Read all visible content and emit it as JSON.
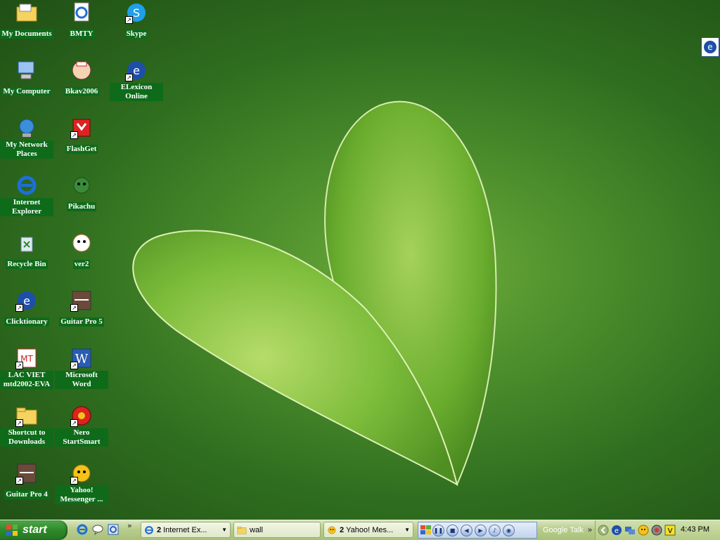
{
  "desktop": {
    "icons_col1": [
      {
        "label": "My Documents",
        "icon": "folder-documents-icon",
        "shortcut": false
      },
      {
        "label": "My Computer",
        "icon": "computer-icon",
        "shortcut": false
      },
      {
        "label": "My Network Places",
        "icon": "network-icon",
        "shortcut": false
      },
      {
        "label": "Internet Explorer",
        "icon": "ie-icon",
        "shortcut": false
      },
      {
        "label": "Recycle Bin",
        "icon": "recycle-bin-icon",
        "shortcut": false
      },
      {
        "label": "Clicktionary",
        "icon": "clicktionary-icon",
        "shortcut": true
      },
      {
        "label": "LAC VIET mtd2002-EVA",
        "icon": "lacviet-icon",
        "shortcut": true
      },
      {
        "label": "Shortcut to Downloads",
        "icon": "folder-icon",
        "shortcut": true
      },
      {
        "label": "Guitar Pro 4",
        "icon": "guitar-pro-icon",
        "shortcut": true
      }
    ],
    "icons_col2": [
      {
        "label": "BMTY",
        "icon": "ie-page-icon",
        "shortcut": false
      },
      {
        "label": "Bkav2006",
        "icon": "bkav-icon",
        "shortcut": false
      },
      {
        "label": "FlashGet",
        "icon": "flashget-icon",
        "shortcut": true
      },
      {
        "label": "Pikachu",
        "icon": "pikachu-icon",
        "shortcut": false
      },
      {
        "label": "ver2",
        "icon": "ver2-icon",
        "shortcut": false
      },
      {
        "label": "Guitar Pro 5",
        "icon": "guitar-pro-icon",
        "shortcut": true
      },
      {
        "label": "Microsoft Word",
        "icon": "word-icon",
        "shortcut": true
      },
      {
        "label": "Nero StartSmart",
        "icon": "nero-icon",
        "shortcut": true
      },
      {
        "label": "Yahoo! Messenger ...",
        "icon": "yahoo-icon",
        "shortcut": true
      }
    ],
    "icons_col3": [
      {
        "label": "Skype",
        "icon": "skype-icon",
        "shortcut": true
      },
      {
        "label": "ELexicon Online",
        "icon": "elexicon-icon",
        "shortcut": true
      }
    ]
  },
  "taskbar": {
    "start_label": "start",
    "tasks": [
      {
        "count": "2",
        "label": "Internet Ex...",
        "icon": "ie-icon"
      },
      {
        "count": "",
        "label": "wall",
        "icon": "folder-icon"
      },
      {
        "count": "2",
        "label": "Yahoo! Mes...",
        "icon": "yahoo-icon"
      }
    ],
    "gtalk_label": "Google Talk",
    "clock": "4:43 PM"
  },
  "colors": {
    "label_bg": "#0e6b1a",
    "taskbar": "#b8cd8c",
    "start": "#2e8a2a"
  }
}
